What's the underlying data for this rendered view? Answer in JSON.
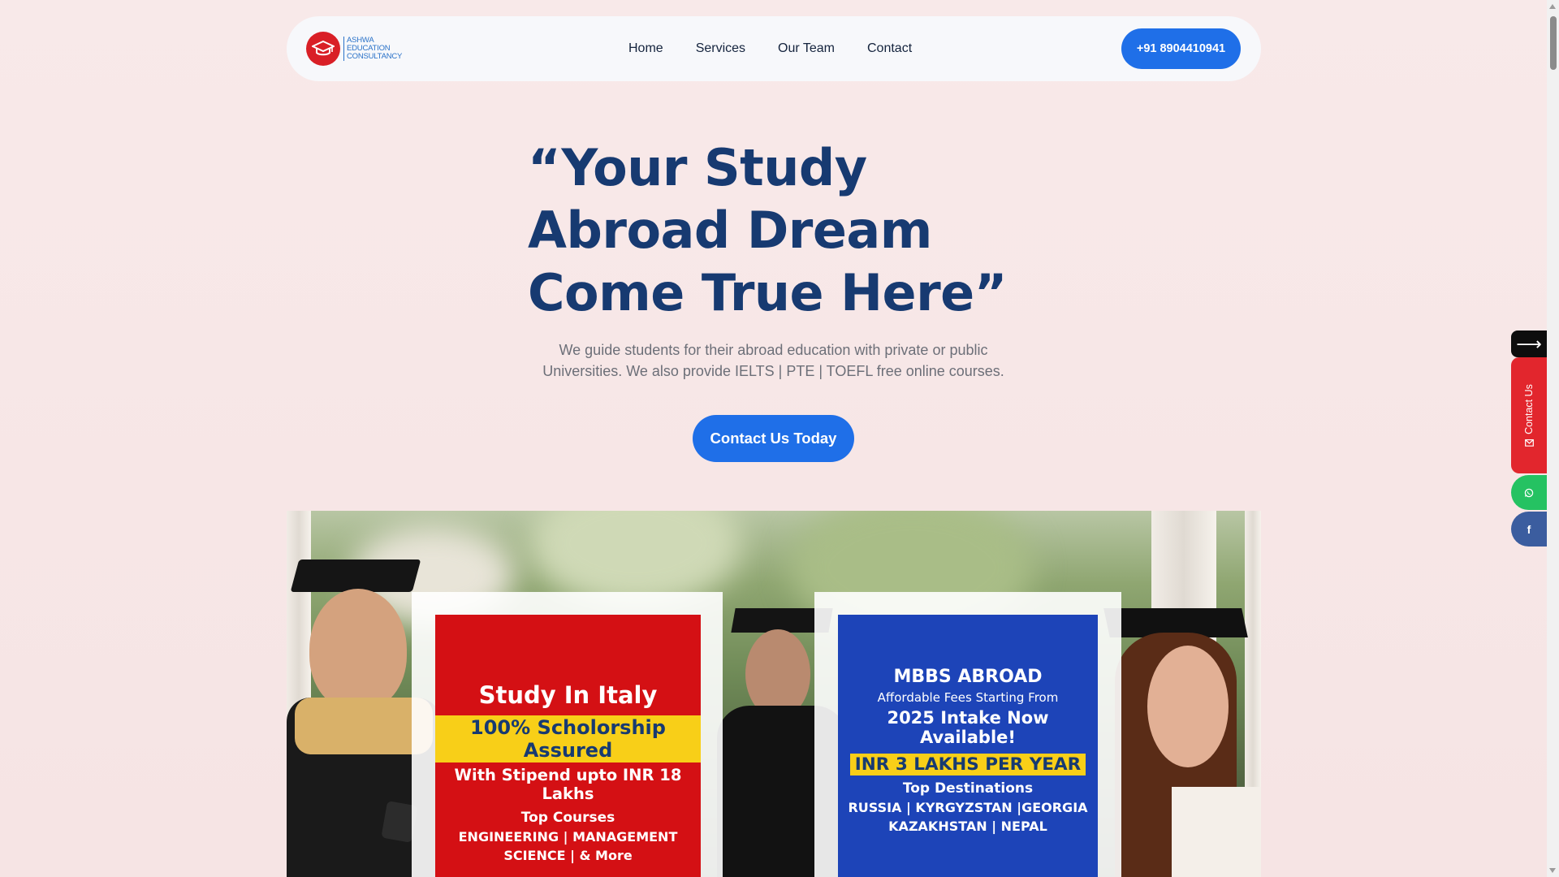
{
  "brand": {
    "logo_line1": "ASHWA",
    "logo_line2": "EDUCATION",
    "logo_line3": "CONSULTANCY",
    "logo_icon": "graduation-cap-icon",
    "logo_color": "#d91f26",
    "text_color": "#2a72c8"
  },
  "nav": {
    "items": [
      {
        "label": "Home"
      },
      {
        "label": "Services"
      },
      {
        "label": "Our Team"
      },
      {
        "label": "Contact"
      }
    ],
    "phone_label": "+91 8904410941"
  },
  "hero": {
    "title": "“Your Study Abroad Dream Come True Here”",
    "subtitle": "We guide students for their abroad education with private or public Universities. We also provide IELTS | PTE | TOEFL free online courses.",
    "cta_label": "Contact Us Today"
  },
  "banner": {
    "poster_italy": {
      "title": "Study In Italy",
      "highlight": "100% Scholorship Assured",
      "line1": "With Stipend upto INR 18 Lakhs",
      "line2": "Top Courses",
      "line3": "ENGINEERING | MANAGEMENT",
      "line4": "SCIENCE | & More",
      "color": "#d41014"
    },
    "poster_mbbs": {
      "title": "MBBS ABROAD",
      "line1": "Affordable Fees Starting From",
      "line2": "2025 Intake Now Available!",
      "highlight": "INR 3 LAKHS PER YEAR",
      "line3": "Top Destinations",
      "line4": "RUSSIA | KYRGYZSTAN |GEORGIA",
      "line5": "KAZAKHSTAN | NEPAL",
      "color": "#1d44b8"
    }
  },
  "side": {
    "arrow": "⟶",
    "contact_label": "Contact Us",
    "contact_icon": "envelope-icon",
    "whatsapp_icon": "whatsapp-icon",
    "facebook_glyph": "f",
    "colors": {
      "contact": "#e2262d",
      "whatsapp": "#25c262",
      "facebook": "#3b5d9f"
    }
  },
  "accent_color": "#1f6fe8",
  "title_color": "#173a71"
}
